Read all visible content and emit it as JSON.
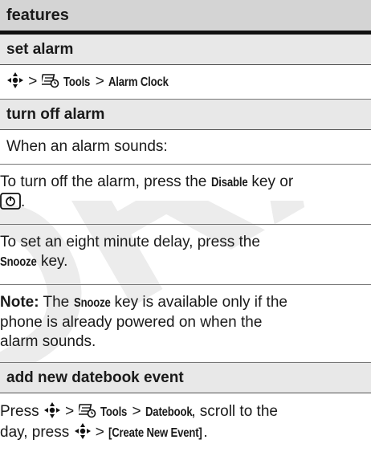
{
  "header": {
    "title": "features"
  },
  "set_alarm": {
    "title": "set alarm",
    "sep1": " > ",
    "tools": "Tools",
    "sep2": " > ",
    "alarm_clock": "Alarm Clock"
  },
  "turn_off": {
    "title": "turn off alarm",
    "p1": "When an alarm sounds:",
    "p2_a": "To turn off the alarm, press the ",
    "p2_disable": "Disable",
    "p2_b": " key or",
    "p2_c": ".",
    "p3_a": "To set an eight minute delay, press the",
    "p3_snooze": "Snooze",
    "p3_b": " key.",
    "note_label": "Note:",
    "note_a": " The ",
    "note_snooze": "Snooze",
    "note_b": " key is available only if the",
    "note_c": "phone is already powered on when the",
    "note_d": "alarm sounds."
  },
  "datebook": {
    "title": "add new datebook event",
    "press": "Press ",
    "sep1": " > ",
    "tools": "Tools",
    "sep2": " > ",
    "datebook": "Datebook",
    "after": ", scroll to the",
    "line2_a": "day, press ",
    "sep3": " > ",
    "create": "[Create New Event]",
    "period": "."
  },
  "watermark": {
    "text": "DRAFT"
  }
}
